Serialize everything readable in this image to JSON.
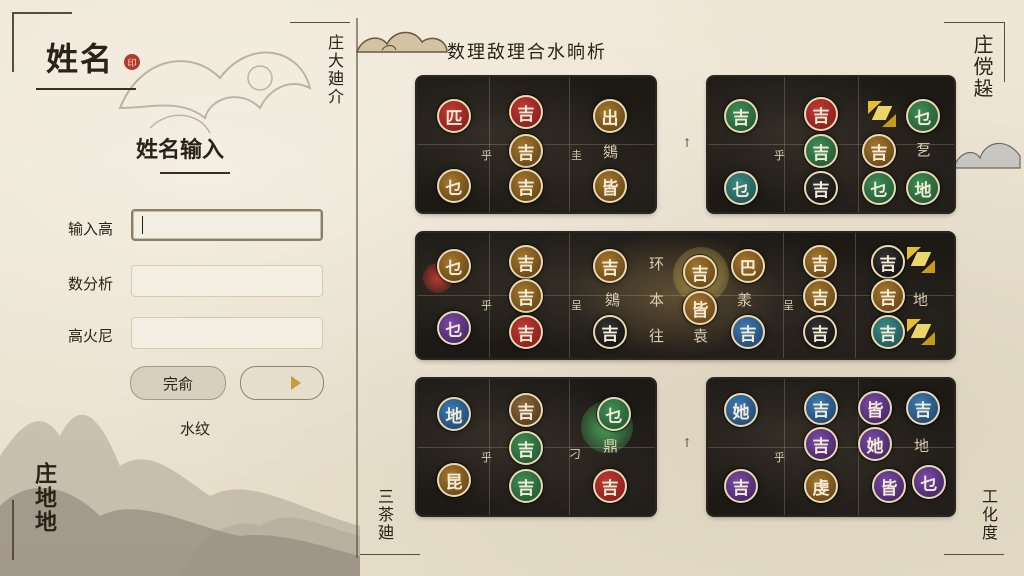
{
  "left": {
    "name_title": "姓名",
    "seal_char": "印",
    "vertical_top": "庄大廸介",
    "vertical_bottom": "庄地地",
    "input_heading": "姓名输入",
    "fields": [
      {
        "label": "输入高",
        "value": "",
        "placeholder": ""
      },
      {
        "label": "数分析",
        "value": "",
        "placeholder": ""
      },
      {
        "label": "高火尼",
        "value": "",
        "placeholder": ""
      }
    ],
    "confirm_label": "完俞",
    "link_label": "水纹"
  },
  "main": {
    "title": "数理敌理合水晌析",
    "vertical_right_top": "庄傥趓",
    "vertical_left_bottom": "三茶廸",
    "vertical_right_bottom": "工化度"
  },
  "boards": {
    "b1": {
      "tokens": [
        {
          "t": "匹",
          "c": "red"
        },
        {
          "t": "吉",
          "c": "red"
        },
        {
          "t": "出",
          "c": "gold"
        },
        {
          "t": "吉",
          "c": "gold"
        },
        {
          "t": "吉",
          "c": "gold"
        },
        {
          "t": "乜",
          "c": "gold"
        },
        {
          "t": "吉",
          "c": "gold"
        },
        {
          "t": "皆",
          "c": "gold"
        }
      ],
      "chars": [
        "乎",
        "圭",
        "鵕"
      ]
    },
    "b2": {
      "tokens": [
        {
          "t": "吉",
          "c": "green"
        },
        {
          "t": "吉",
          "c": "red"
        },
        {
          "t": "乜",
          "c": "green"
        },
        {
          "t": "吉",
          "c": "green"
        },
        {
          "t": "吉",
          "c": "gold"
        },
        {
          "t": "乜",
          "c": "teal"
        },
        {
          "t": "吉",
          "c": "black"
        },
        {
          "t": "乜",
          "c": "green"
        },
        {
          "t": "地",
          "c": "green"
        }
      ],
      "chars": [
        "乎",
        "乭"
      ]
    },
    "b3": {
      "tokens": [
        {
          "t": "乜",
          "c": "gold"
        },
        {
          "t": "吉",
          "c": "gold"
        },
        {
          "t": "吉",
          "c": "gold"
        },
        {
          "t": "吉",
          "c": "gold"
        },
        {
          "t": "吉",
          "c": "gold"
        },
        {
          "t": "乜",
          "c": "purple"
        },
        {
          "t": "吉",
          "c": "red"
        },
        {
          "t": "吉",
          "c": "black"
        },
        {
          "t": "吉",
          "c": "gold"
        },
        {
          "t": "皆",
          "c": "gold"
        },
        {
          "t": "巴",
          "c": "gold"
        },
        {
          "t": "吉",
          "c": "blue"
        },
        {
          "t": "吉",
          "c": "gold"
        },
        {
          "t": "吉",
          "c": "black"
        },
        {
          "t": "吉",
          "c": "gold"
        },
        {
          "t": "吉",
          "c": "gold"
        },
        {
          "t": "吉",
          "c": "black"
        },
        {
          "t": "吉",
          "c": "teal"
        }
      ],
      "chars": [
        "乎",
        "呈",
        "鵕",
        "环",
        "本",
        "往",
        "羕",
        "袁",
        "呈",
        "地"
      ]
    },
    "b4": {
      "tokens": [
        {
          "t": "地",
          "c": "blue"
        },
        {
          "t": "吉",
          "c": "brown"
        },
        {
          "t": "乜",
          "c": "green"
        },
        {
          "t": "吉",
          "c": "green"
        },
        {
          "t": "昆",
          "c": "gold"
        },
        {
          "t": "吉",
          "c": "green"
        },
        {
          "t": "吉",
          "c": "red"
        }
      ],
      "chars": [
        "乎",
        "刁",
        "鼎"
      ]
    },
    "b5": {
      "tokens": [
        {
          "t": "她",
          "c": "blue"
        },
        {
          "t": "吉",
          "c": "blue"
        },
        {
          "t": "皆",
          "c": "purple"
        },
        {
          "t": "吉",
          "c": "blue"
        },
        {
          "t": "吉",
          "c": "purple"
        },
        {
          "t": "她",
          "c": "purple"
        },
        {
          "t": "吉",
          "c": "purple"
        },
        {
          "t": "虔",
          "c": "gold"
        },
        {
          "t": "皆",
          "c": "purple"
        },
        {
          "t": "乜",
          "c": "purple"
        }
      ],
      "chars": [
        "乎",
        "地"
      ]
    }
  },
  "colors": {
    "paper": "#ece4d2",
    "board": "#1d1a16",
    "ink": "#2a2118",
    "seal_red": "#b23a2b",
    "gold_gem": "#e6c02c"
  },
  "icons": [
    "cloud-icon",
    "seal-icon",
    "mountain-illustration",
    "arrow-right-icon",
    "gem-icon"
  ]
}
